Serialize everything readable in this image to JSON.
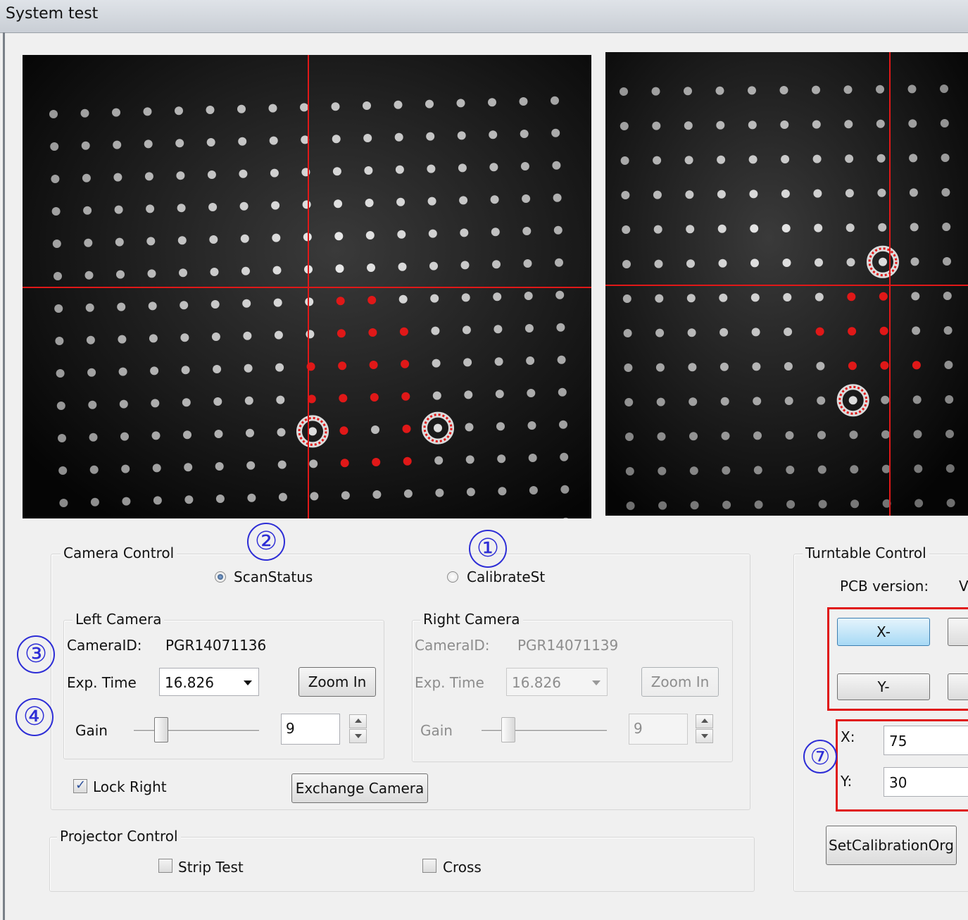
{
  "window": {
    "title": "System test"
  },
  "camera_control": {
    "legend": "Camera Control",
    "scan_status_label": "ScanStatus",
    "calibrate_label": "CalibrateSt",
    "scan_status_selected": true,
    "left": {
      "legend": "Left Camera",
      "camera_id_label": "CameraID:",
      "camera_id": "PGR14071136",
      "exp_label": "Exp. Time",
      "exp_value": "16.826",
      "zoom_label": "Zoom In",
      "gain_label": "Gain",
      "gain_value": "9"
    },
    "right": {
      "legend": "Right Camera",
      "camera_id_label": "CameraID:",
      "camera_id": "PGR14071139",
      "exp_label": "Exp. Time",
      "exp_value": "16.826",
      "zoom_label": "Zoom In",
      "gain_label": "Gain",
      "gain_value": "9"
    },
    "lock_right_label": "Lock Right",
    "lock_right_checked": true,
    "exchange_label": "Exchange Camera"
  },
  "projector_control": {
    "legend": "Projector Control",
    "strip_test_label": "Strip Test",
    "cross_label": "Cross"
  },
  "turntable_control": {
    "legend": "Turntable Control",
    "pcb_label": "PCB version:",
    "pcb_value": "V",
    "x_minus_label": "X-",
    "y_minus_label": "Y-",
    "x_label": "X:",
    "x_value": "75",
    "y_label": "Y:",
    "y_value": "30",
    "set_org_label": "SetCalibrationOrg"
  },
  "annotations": [
    "①",
    "②",
    "③",
    "④",
    "⑦"
  ],
  "colors": {
    "marker": "#e01818",
    "annotation": "#2d2dd6",
    "background": "#f0f0f0"
  }
}
